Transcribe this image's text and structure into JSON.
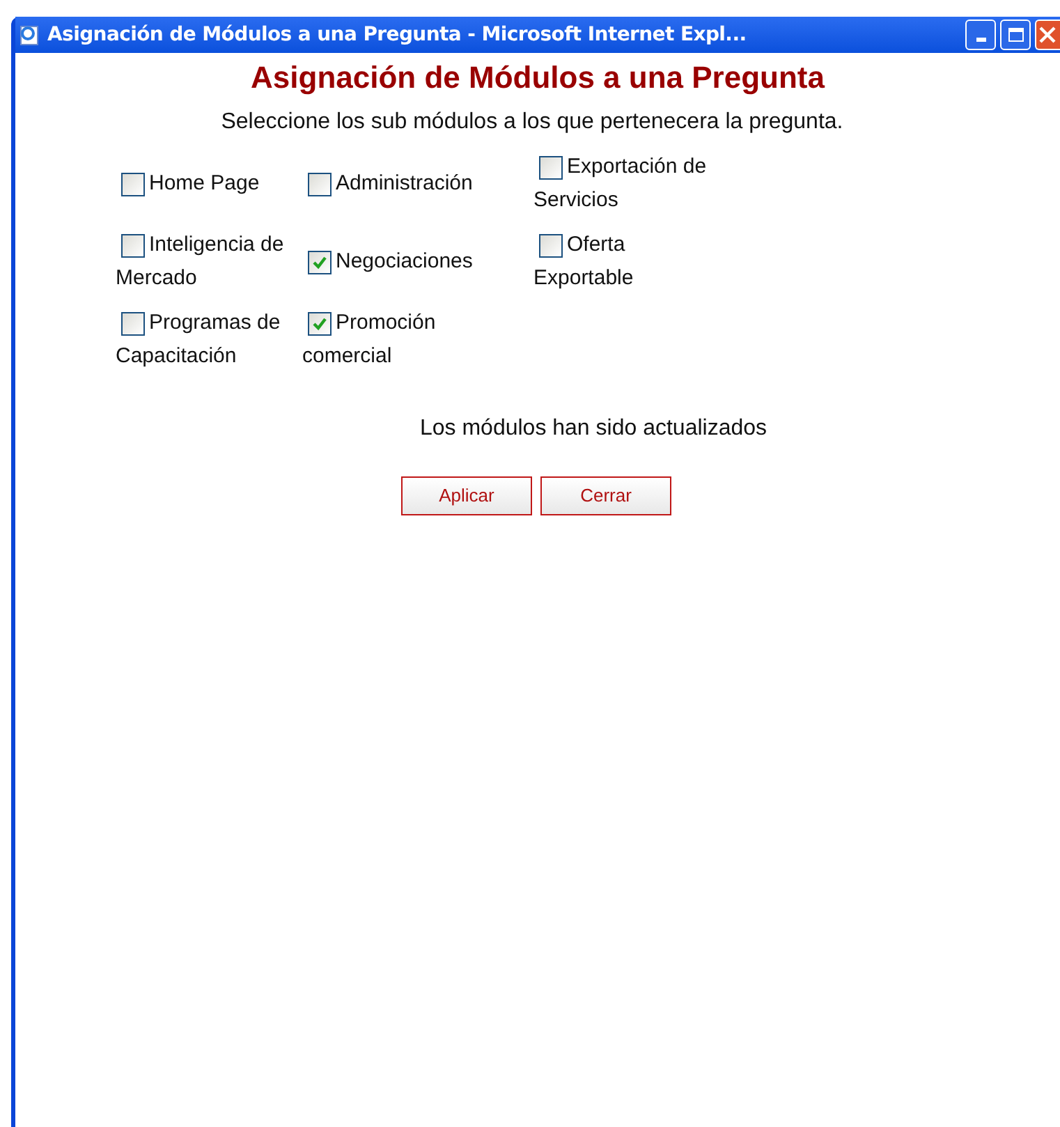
{
  "window": {
    "title": "Asignación de Módulos a una Pregunta - Microsoft Internet Expl..."
  },
  "heading": "Asignación de Módulos a una Pregunta",
  "instruction": "Seleccione los sub módulos a los que pertenecera la pregunta.",
  "modules": [
    [
      {
        "label": "Home Page",
        "checked": false
      },
      {
        "label": "Administración",
        "checked": false
      },
      {
        "label": "Exportación de Servicios",
        "checked": false
      }
    ],
    [
      {
        "label": "Inteligencia de Mercado",
        "checked": false
      },
      {
        "label": "Negociaciones",
        "checked": true
      },
      {
        "label": "Oferta Exportable",
        "checked": false
      }
    ],
    [
      {
        "label": "Programas de Capacitación",
        "checked": false
      },
      {
        "label": "Promoción comercial",
        "checked": true
      }
    ]
  ],
  "status": "Los módulos han sido actualizados",
  "buttons": [
    "Aplicar",
    "Cerrar"
  ]
}
